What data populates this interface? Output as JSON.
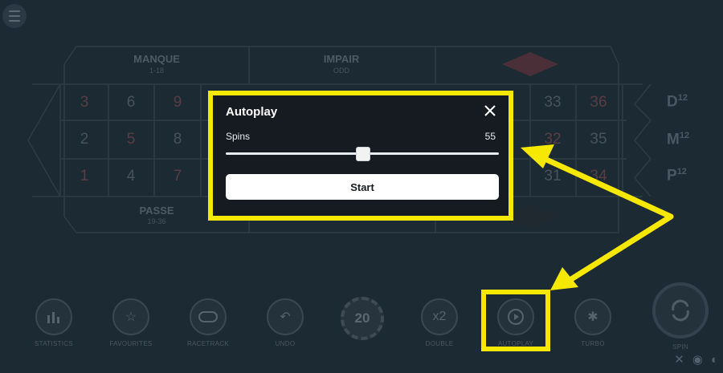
{
  "table": {
    "top_left_label": "MANQUE",
    "top_left_sub": "1-18",
    "top_mid_label": "IMPAIR",
    "top_mid_sub": "ODD",
    "bottom_left_label": "PASSE",
    "bottom_left_sub": "19-36",
    "numbers": [
      {
        "text": "3",
        "red": true
      },
      {
        "text": "6",
        "red": false
      },
      {
        "text": "9",
        "red": true
      },
      {
        "text": "2",
        "red": false
      },
      {
        "text": "5",
        "red": true
      },
      {
        "text": "8",
        "red": false
      },
      {
        "text": "1",
        "red": true
      },
      {
        "text": "4",
        "red": false
      },
      {
        "text": "7",
        "red": true
      },
      {
        "text": "33",
        "red": false
      },
      {
        "text": "36",
        "red": true
      },
      {
        "text": "32",
        "red": true
      },
      {
        "text": "35",
        "red": false
      },
      {
        "text": "31",
        "red": false
      },
      {
        "text": "34",
        "red": true
      }
    ],
    "dozens": [
      {
        "letter": "D",
        "sup": "12"
      },
      {
        "letter": "M",
        "sup": "12"
      },
      {
        "letter": "P",
        "sup": "12"
      }
    ]
  },
  "toolbar": {
    "items": [
      {
        "label": "STATISTICS",
        "icon": "bar-chart-icon"
      },
      {
        "label": "FAVOURITES",
        "icon": "star-icon"
      },
      {
        "label": "RACETRACK",
        "icon": "racetrack-icon"
      },
      {
        "label": "UNDO",
        "icon": "undo-icon"
      },
      {
        "label": "",
        "icon": "chip-icon",
        "chip_value": "20"
      },
      {
        "label": "DOUBLE",
        "icon": "double-icon",
        "glyph": "x2"
      },
      {
        "label": "AUTOPLAY",
        "icon": "autoplay-icon"
      },
      {
        "label": "TURBO",
        "icon": "turbo-icon"
      }
    ],
    "spin_label": "SPIN"
  },
  "modal": {
    "title": "Autoplay",
    "spins_label": "Spins",
    "spins_value": "55",
    "slider_fraction": 0.5,
    "start_label": "Start"
  },
  "colors": {
    "highlight": "#f6e800",
    "background": "#1c2a33",
    "modal_bg": "#151b21"
  }
}
